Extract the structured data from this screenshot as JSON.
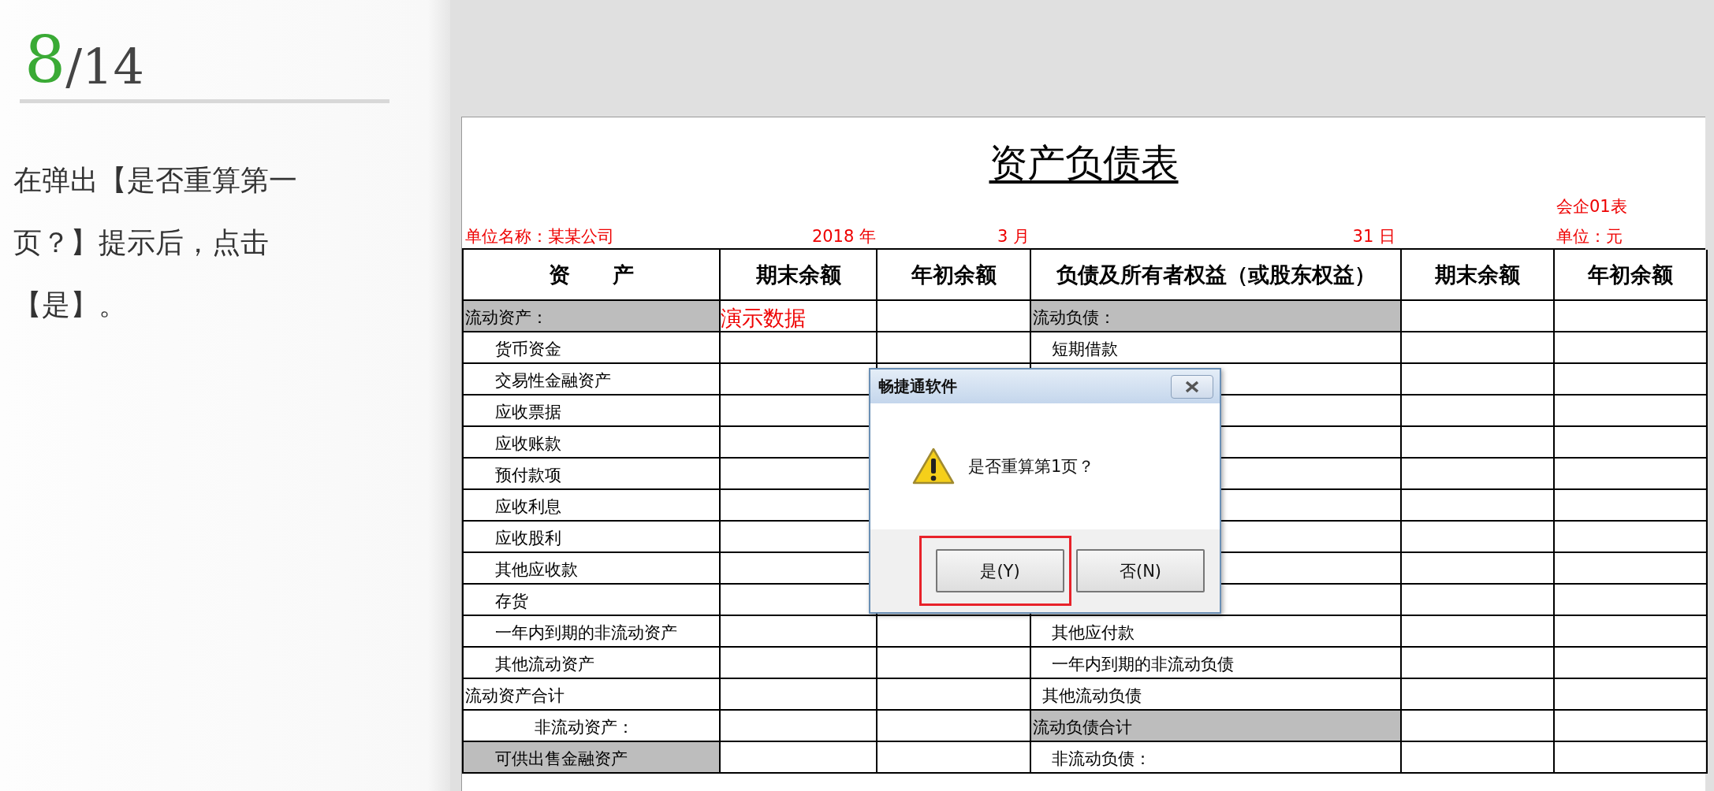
{
  "slide": {
    "page_current": "8",
    "page_total": "/14",
    "instruction": "在弹出【是否重算第一页？】提示后，点击【是】。"
  },
  "sheet": {
    "title": "资产负债表",
    "form_code": "会企01表",
    "company": "单位名称：某某公司",
    "year": "2018 年",
    "month": "3 月",
    "day": "31 日",
    "unit": "单位：元",
    "demo_label": "演示数据",
    "columns": [
      "资　　产",
      "期末余额",
      "年初余额",
      "负债及所有者权益（或股东权益）",
      "期末余额",
      "年初余额"
    ],
    "rows": [
      {
        "left": {
          "label": "流动资产：",
          "kind": "section",
          "shaded": true
        },
        "right": {
          "label": "流动负债：",
          "kind": "section",
          "shaded": true
        }
      },
      {
        "left": {
          "label": "货币资金",
          "kind": "item",
          "shaded": false
        },
        "right": {
          "label": "短期借款",
          "kind": "item",
          "shaded": false
        }
      },
      {
        "left": {
          "label": "交易性金融资产",
          "kind": "item",
          "shaded": false
        },
        "right": null
      },
      {
        "left": {
          "label": "应收票据",
          "kind": "item",
          "shaded": false
        },
        "right": null
      },
      {
        "left": {
          "label": "应收账款",
          "kind": "item",
          "shaded": false
        },
        "right": null
      },
      {
        "left": {
          "label": "预付款项",
          "kind": "item",
          "shaded": false
        },
        "right": null
      },
      {
        "left": {
          "label": "应收利息",
          "kind": "item",
          "shaded": false
        },
        "right": null
      },
      {
        "left": {
          "label": "应收股利",
          "kind": "item",
          "shaded": false
        },
        "right": null
      },
      {
        "left": {
          "label": "其他应收款",
          "kind": "item",
          "shaded": false
        },
        "right": null
      },
      {
        "left": {
          "label": "存货",
          "kind": "item",
          "shaded": false
        },
        "right": null
      },
      {
        "left": {
          "label": "一年内到期的非流动资产",
          "kind": "item",
          "shaded": false
        },
        "right": {
          "label": "其他应付款",
          "kind": "item",
          "shaded": false
        }
      },
      {
        "left": {
          "label": "其他流动资产",
          "kind": "item",
          "shaded": false
        },
        "right": {
          "label": "一年内到期的非流动负债",
          "kind": "item",
          "shaded": false
        }
      },
      {
        "left": {
          "label": "流动资产合计",
          "kind": "total",
          "shaded": false
        },
        "right": {
          "label": "其他流动负债",
          "kind": "minor",
          "shaded": false
        }
      },
      {
        "left": {
          "label": "非流动资产：",
          "kind": "subheading",
          "shaded": false
        },
        "right": {
          "label": "流动负债合计",
          "kind": "total",
          "shaded": true
        }
      },
      {
        "left": {
          "label": "可供出售金融资产",
          "kind": "item",
          "shaded": true
        },
        "right": {
          "label": "非流动负债：",
          "kind": "item",
          "shaded": false
        }
      }
    ]
  },
  "dialog": {
    "title": "畅捷通软件",
    "message": "是否重算第1页？",
    "buttons": [
      {
        "label": "是(Y)",
        "highlighted": true
      },
      {
        "label": "否(N)",
        "highlighted": false
      }
    ]
  }
}
